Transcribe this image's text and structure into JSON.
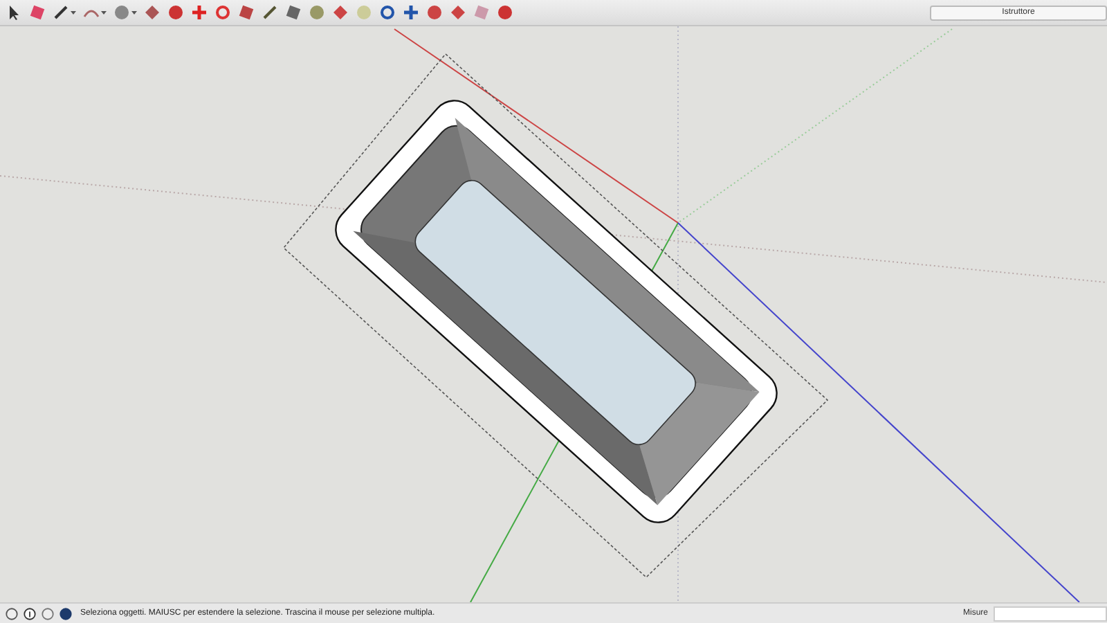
{
  "toolbar": {
    "search": {
      "value": "Istruttore"
    }
  },
  "status_bar": {
    "message": "Seleziona oggetti. MAIUSC per estendere la selezione. Trascina il mouse per selezione multipla.",
    "measurements_label": "Misure"
  }
}
